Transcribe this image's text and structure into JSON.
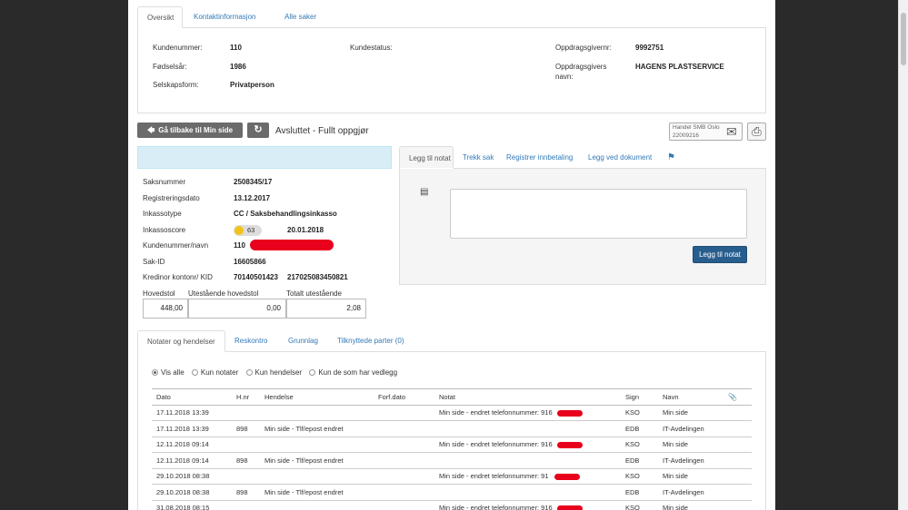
{
  "top_tabs": [
    {
      "label": "Oversikt"
    },
    {
      "label": "Kontaktinformasjon"
    },
    {
      "label": "Alle saker"
    }
  ],
  "overview": {
    "kundenummer_label": "Kundenummer:",
    "kundenummer": "110",
    "fodselsar_label": "Fødselsår:",
    "fodselsar": "1986",
    "selskapsform_label": "Selskapsform:",
    "selskapsform": "Privatperson",
    "kundestatus_label": "Kundestatus:",
    "oppdragsgivernr_label": "Oppdragsgivernr:",
    "oppdragsgivernr": "9992751",
    "oppdragsgivers_navn_label_1": "Oppdragsgivers",
    "oppdragsgivers_navn_label_2": "navn:",
    "oppdragsgivers_navn": "HAGENS PLASTSERVICE"
  },
  "toolbar": {
    "back_label": "Gå tilbake til Min side",
    "back_arrow": "🡄",
    "refresh_icon": "↻",
    "status_text": "Avsluttet - Fullt oppgjør",
    "mail_line1": "Handel SMB Oslo",
    "mail_line2": "22009216",
    "mail_icon": "✉",
    "print_icon": "⎙"
  },
  "case": {
    "saksnummer_label": "Saksnummer",
    "saksnummer": "2508345/17",
    "registreringsdato_label": "Registreringsdato",
    "registreringsdato": "13.12.2017",
    "inkassotype_label": "Inkassotype",
    "inkassotype": "CC / Saksbehandlingsinkasso",
    "inkassoscore_label": "Inkassoscore",
    "inkassoscore": "63",
    "inkassoscore_date": "20.01.2018",
    "kundenummer_navn_label": "Kundenummer/navn",
    "kundenummer_navn": "110",
    "sak_id_label": "Sak-ID",
    "sak_id": "16605866",
    "kreditor_label": "Kredinor kontonr/ KID",
    "kreditor_konto": "70140501423",
    "kreditor_kid": "217025083450821",
    "hovedstol_label": "Hovedstol",
    "utestaende_label": "Utestående hovedstol",
    "totalt_label": "Totalt utestående",
    "hovedstol": "448,00",
    "utestaende": "0,00",
    "totalt": "2,08"
  },
  "note_tabs": [
    {
      "label": "Legg til notat"
    },
    {
      "label": "Trekk sak"
    },
    {
      "label": "Registrer innbetaling"
    },
    {
      "label": "Legg ved dokument"
    }
  ],
  "note": {
    "flag_icon": "⚑",
    "doc_icon": "▤",
    "textarea_value": "",
    "submit_label": "Legg til notat"
  },
  "bottom_tabs": [
    {
      "label": "Notater og hendelser"
    },
    {
      "label": "Reskontro"
    },
    {
      "label": "Grunnlag"
    },
    {
      "label": "Tilknyttede parter (0)"
    }
  ],
  "filters": {
    "selected": "Vis alle",
    "options": [
      "Vis alle",
      "Kun notater",
      "Kun hendelser",
      "Kun de som har vedlegg"
    ]
  },
  "events": {
    "columns": [
      "Dato",
      "H.nr",
      "Hendelse",
      "Forf.dato",
      "Notat",
      "Sign",
      "Navn"
    ],
    "attach_icon": "📎",
    "rows": [
      {
        "dato": "17.11.2018 13:39",
        "hnr": "",
        "hendelse": "",
        "forf": "",
        "notat": "Min side - endret telefonnummer: 916",
        "sign": "KSO",
        "navn": "Min side"
      },
      {
        "dato": "17.11.2018 13:39",
        "hnr": "898",
        "hendelse": "Min side - Tlf/epost endret",
        "forf": "",
        "notat": "",
        "sign": "EDB",
        "navn": "IT-Avdelingen"
      },
      {
        "dato": "12.11.2018 09:14",
        "hnr": "",
        "hendelse": "",
        "forf": "",
        "notat": "Min side - endret telefonnummer: 916",
        "sign": "KSO",
        "navn": "Min side"
      },
      {
        "dato": "12.11.2018 09:14",
        "hnr": "898",
        "hendelse": "Min side - Tlf/epost endret",
        "forf": "",
        "notat": "",
        "sign": "EDB",
        "navn": "IT-Avdelingen"
      },
      {
        "dato": "29.10.2018 08:38",
        "hnr": "",
        "hendelse": "",
        "forf": "",
        "notat": "Min side - endret telefonnummer: 91",
        "sign": "KSO",
        "navn": "Min side"
      },
      {
        "dato": "29.10.2018 08:38",
        "hnr": "898",
        "hendelse": "Min side - Tlf/epost endret",
        "forf": "",
        "notat": "",
        "sign": "EDB",
        "navn": "IT-Avdelingen"
      },
      {
        "dato": "31.08.2018 08:15",
        "hnr": "",
        "hendelse": "",
        "forf": "",
        "notat": "Min side - endret telefonnummer: 916",
        "sign": "KSO",
        "navn": "Min side"
      }
    ]
  },
  "colors": {
    "link": "#337ab7",
    "info_bar": "#d9edf7",
    "primary": "#285e8e",
    "redaction": "#e8001c"
  }
}
